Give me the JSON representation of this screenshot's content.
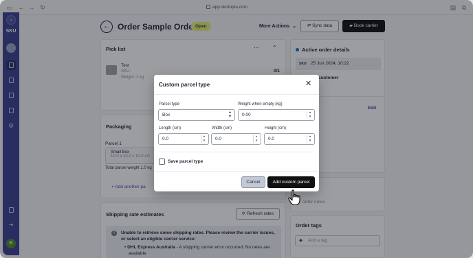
{
  "browser": {
    "url": "app.skutopia.com",
    "icons": [
      "sidebar-toggle-icon",
      "back-arrow-icon",
      "forward-arrow-icon",
      "reload-icon",
      "lock-icon",
      "reader-icon",
      "tabs-icon"
    ]
  },
  "sidebar": {
    "logo": "SKU",
    "user_initial": "K",
    "items": [
      {
        "name": "orders",
        "active": true
      },
      {
        "name": "documents",
        "active": false
      },
      {
        "name": "inventory",
        "active": false
      },
      {
        "name": "shipments",
        "active": false
      },
      {
        "name": "settings",
        "active": false
      },
      {
        "name": "help",
        "active": false
      },
      {
        "name": "logout",
        "active": false
      }
    ]
  },
  "header": {
    "title": "Order Sample Order",
    "status": "Open",
    "more_actions": "More Actions",
    "sync_label": "Sync data",
    "book_carrier_label": "Book carrier"
  },
  "pick_list": {
    "title": "Pick list",
    "item_name": "Test",
    "sku_label": "SKU:",
    "weight": "Weight: 1 kg",
    "count": "0/1"
  },
  "packaging": {
    "title": "Packaging",
    "parcel_label": "Parcel 1",
    "box_name": "Small Box",
    "box_dims": "10.0 x 10.0 x 10.0 cm",
    "total_weight": "Total parcel weight 1.0 kg",
    "add_label": "Add another pa"
  },
  "shipping": {
    "title": "Shipping rate estimates",
    "refresh_label": "Refresh rates",
    "warning_title": "Unable to retrieve some shipping rates. Please review the carrier issues, or select an eligible carrier service:",
    "carrier_name": "DHL Express Australia",
    "carrier_error": " - A shipping carrier error occurred: No rates are",
    "carrier_error_2": "available"
  },
  "active_order": {
    "title": "Active order details",
    "date": "25 Jun 2024, 10:22",
    "by": "d by customer"
  },
  "edit_card": {
    "edit_label": "Edit"
  },
  "notes_card": {
    "title_tail": "es",
    "placeholder": "order notes"
  },
  "tags": {
    "title": "Order tags",
    "placeholder": "Add a tag"
  },
  "modal": {
    "title": "Custom parcel type",
    "parcel_type_label": "Parcel type",
    "parcel_type_value": "Box",
    "weight_label": "Weight when empty (kg)",
    "weight_value": "0.00",
    "length_label": "Length (cm)",
    "length_value": "0.0",
    "width_label": "Width (cm)",
    "width_value": "0.0",
    "height_label": "Height (cm)",
    "height_value": "0.0",
    "save_label": "Save parcel type",
    "save_checked": false,
    "cancel_label": "Cancel",
    "add_label": "Add custom parcel"
  },
  "colors": {
    "sidebar": "#3b3f8f",
    "badge_open": "#e5ee7d",
    "primary_button": "#111111",
    "overlay": "rgba(20,22,30,0.42)"
  }
}
